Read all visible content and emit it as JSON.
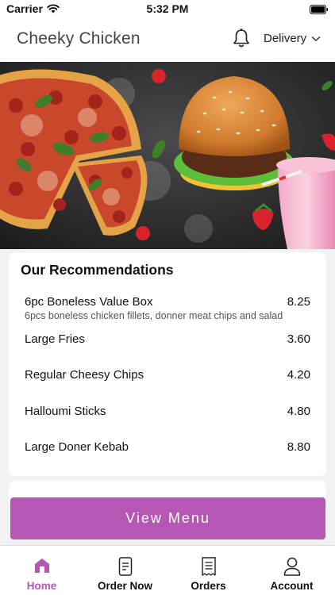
{
  "status_bar": {
    "carrier": "Carrier",
    "time": "5:32 PM"
  },
  "header": {
    "title": "Cheeky Chicken",
    "delivery_label": "Delivery"
  },
  "recommendations": {
    "heading": "Our Recommendations",
    "items": [
      {
        "name": "6pc Boneless Value Box",
        "price": "8.25",
        "description": "6pcs boneless chicken fillets, donner meat chips and salad"
      },
      {
        "name": "Large Fries",
        "price": "3.60"
      },
      {
        "name": "Regular Cheesy Chips",
        "price": "4.20"
      },
      {
        "name": "Halloumi Sticks",
        "price": "4.80"
      },
      {
        "name": "Large Doner Kebab",
        "price": "8.80"
      }
    ]
  },
  "view_menu_label": "View Menu",
  "tabs": [
    {
      "label": "Home",
      "icon": "home-icon",
      "active": true
    },
    {
      "label": "Order Now",
      "icon": "phone-order-icon",
      "active": false
    },
    {
      "label": "Orders",
      "icon": "receipt-icon",
      "active": false
    },
    {
      "label": "Account",
      "icon": "person-icon",
      "active": false
    }
  ],
  "colors": {
    "accent": "#b657b6",
    "background": "#f2f2f4"
  }
}
